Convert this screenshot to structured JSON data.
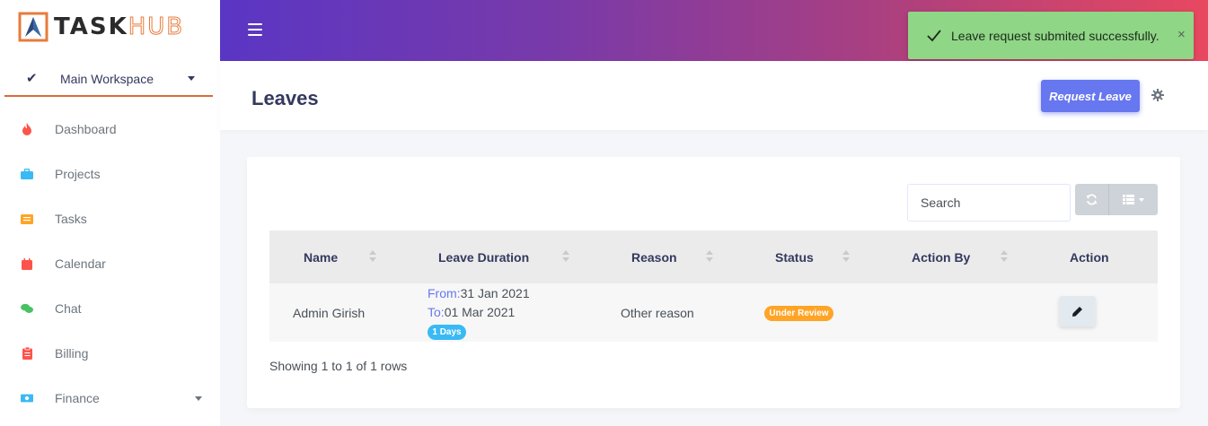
{
  "brand": {
    "part1": "TASK",
    "part2": "HUB"
  },
  "workspace": {
    "label": "Main Workspace"
  },
  "sidebar": {
    "items": [
      {
        "label": "Dashboard",
        "icon": "fire-icon",
        "color": "#fc544b"
      },
      {
        "label": "Projects",
        "icon": "briefcase-icon",
        "color": "#3abaf4"
      },
      {
        "label": "Tasks",
        "icon": "list-icon",
        "color": "#ffa426"
      },
      {
        "label": "Calendar",
        "icon": "calendar-icon",
        "color": "#fc544b"
      },
      {
        "label": "Chat",
        "icon": "chat-icon",
        "color": "#47c363"
      },
      {
        "label": "Billing",
        "icon": "clipboard-icon",
        "color": "#fc544b"
      },
      {
        "label": "Finance",
        "icon": "money-icon",
        "color": "#3abaf4"
      }
    ]
  },
  "toast": {
    "message": "Leave request submited successfully.",
    "close": "×"
  },
  "header": {
    "title": "Leaves",
    "request_label": "Request Leave"
  },
  "toolbar": {
    "search_placeholder": "Search"
  },
  "table": {
    "columns": [
      "Name",
      "Leave Duration",
      "Reason",
      "Status",
      "Action By",
      "Action"
    ],
    "rows": [
      {
        "name": "Admin Girish",
        "from_label": "From:",
        "from": "31 Jan 2021",
        "to_label": "To:",
        "to": "01 Mar 2021",
        "days": "1 Days",
        "reason": "Other reason",
        "status": "Under Review",
        "action_by": ""
      }
    ]
  },
  "pagination": {
    "info": "Showing 1 to 1 of 1 rows"
  },
  "colors": {
    "primary": "#6777ef",
    "info": "#3abaf4",
    "warning": "#ffa426",
    "toast": "#8fd686",
    "accent": "#d9693a"
  }
}
